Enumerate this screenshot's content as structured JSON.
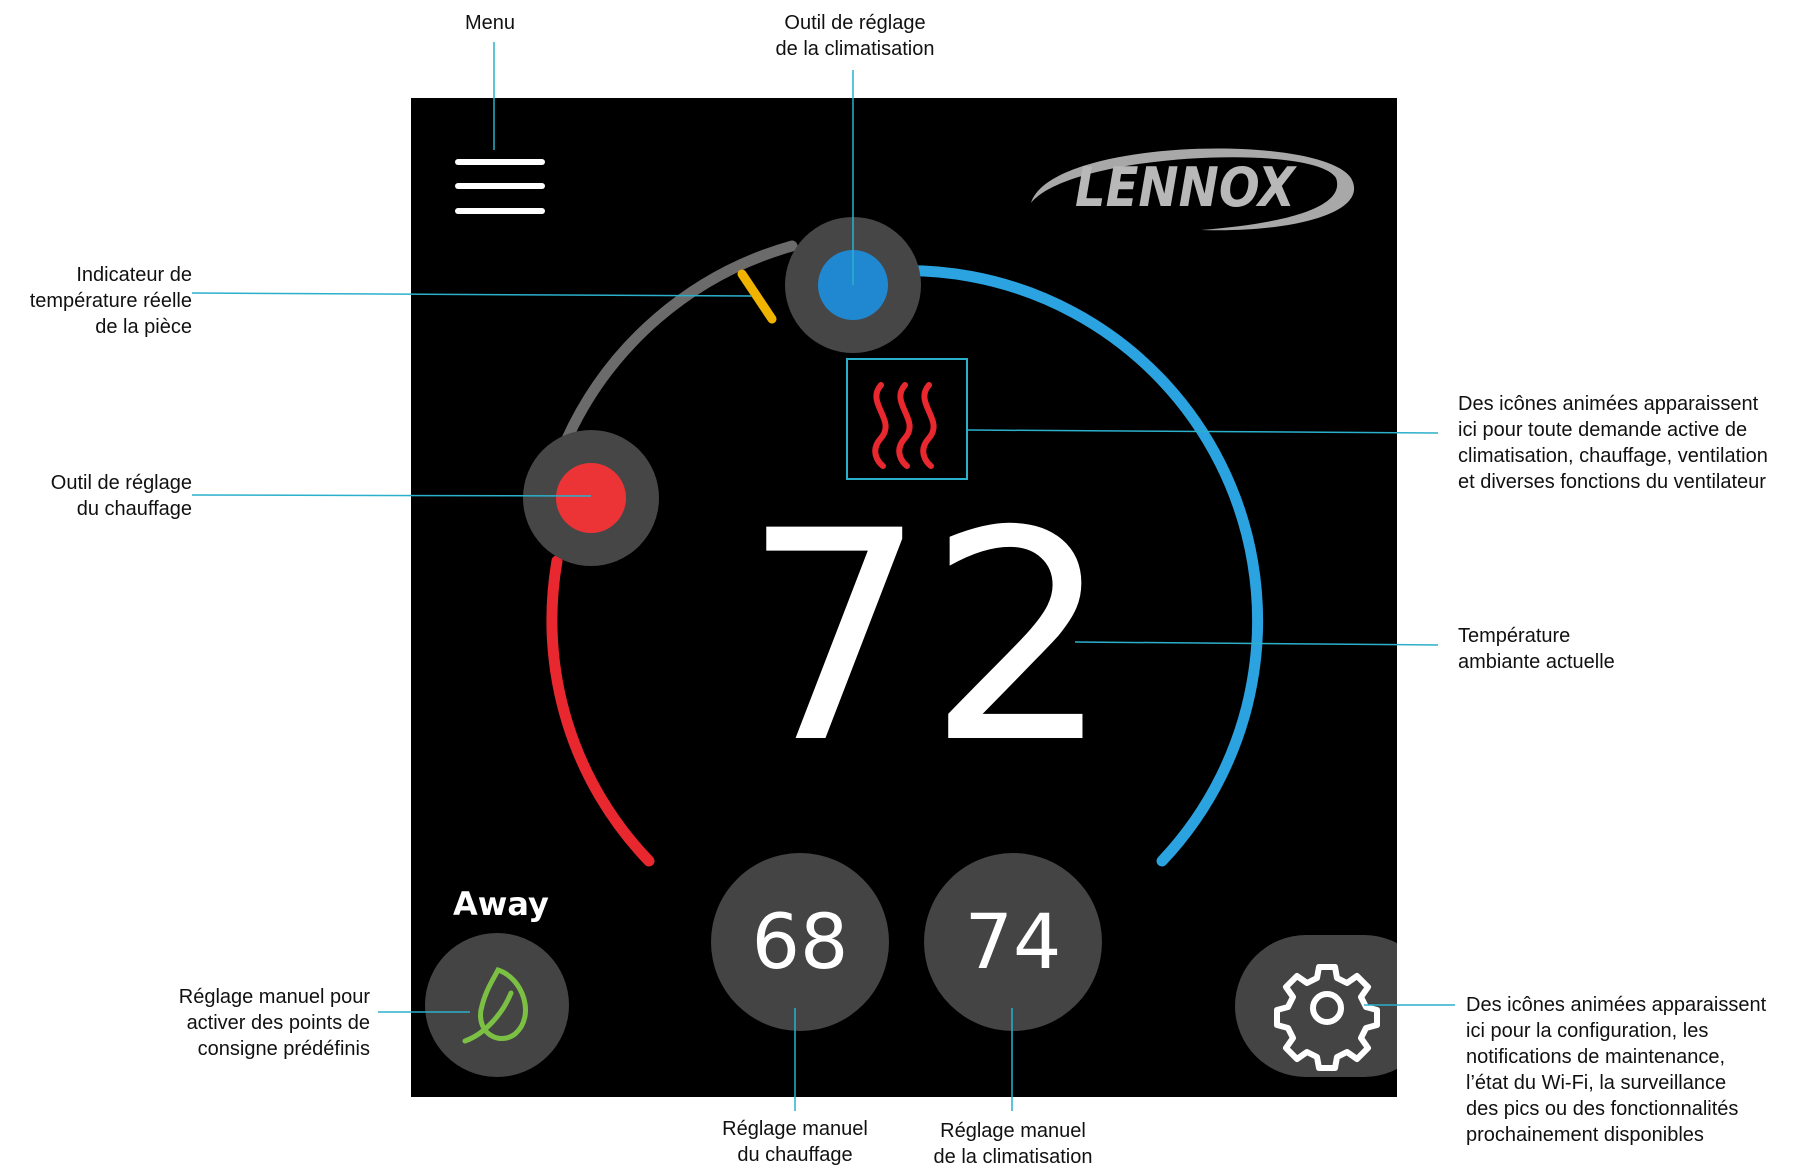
{
  "device": {
    "brand_logo": "LENNOX",
    "current_temperature": "72",
    "heat_setpoint": "68",
    "cool_setpoint": "74",
    "mode_label": "Away",
    "icons": {
      "menu": "hamburger-menu-icon",
      "demand": "heat-waves-icon",
      "away": "leaf-icon",
      "settings": "gear-icon"
    },
    "colors": {
      "heat": "#e8282e",
      "cool": "#2aa3e0",
      "room_indicator": "#f0b400",
      "neutral_arc": "#6b6b6b",
      "away_leaf": "#7bc043",
      "callout_line": "#2bb0cc"
    }
  },
  "annotations": {
    "menu": "Menu",
    "cool_tool": "Outil de réglage\nde la climatisation",
    "room_indicator": "Indicateur de\ntempérature réelle\nde la pièce",
    "heat_tool": "Outil de réglage\ndu chauffage",
    "demand_icons": "Des icônes animées apparaissent\nici pour toute demande active de\nclimatisation, chauffage, ventilation\net diverses fonctions du ventilateur",
    "current_temp": "Température\nambiante actuelle",
    "away_setting": "Réglage manuel pour\nactiver des points de\nconsigne prédéfinis",
    "manual_heat": "Réglage manuel\ndu chauffage",
    "manual_cool": "Réglage manuel\nde la climatisation",
    "settings_icons": "Des icônes animées apparaissent\nici pour la configuration, les\nnotifications de maintenance,\nl’état du Wi-Fi, la surveillance\ndes pics ou des fonctionnalités\nprochainement disponibles"
  }
}
